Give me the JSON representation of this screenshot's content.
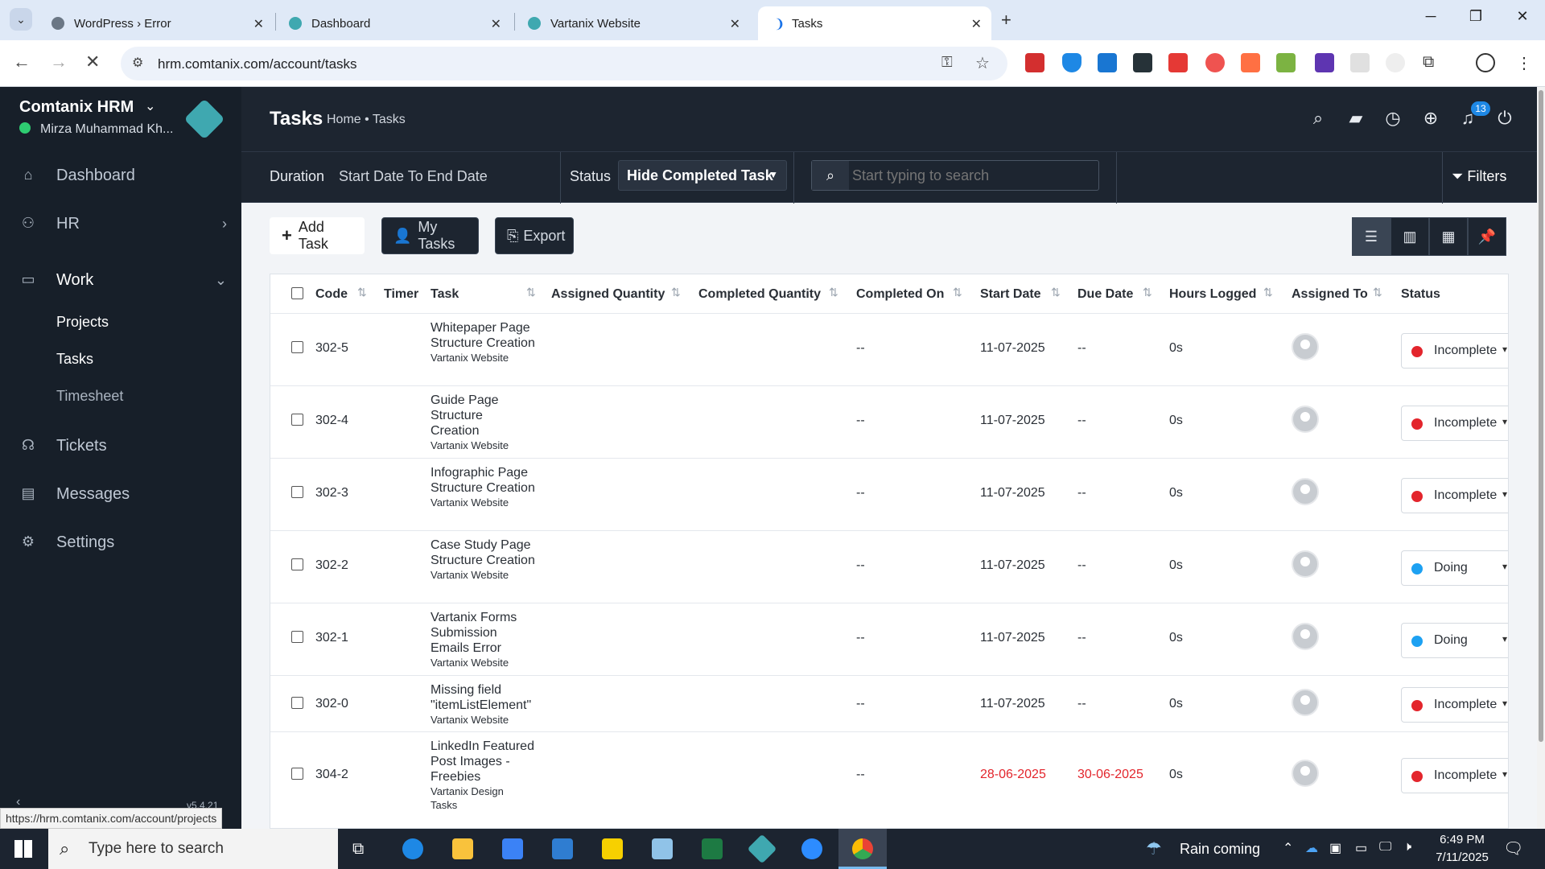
{
  "browser": {
    "tabs": [
      {
        "label": "WordPress › Error",
        "color": "#6b7785"
      },
      {
        "label": "Dashboard",
        "color": "#3fa8b0"
      },
      {
        "label": "Vartanix Website",
        "color": "#3fa8b0"
      },
      {
        "label": "Tasks",
        "color": "#1a73e8",
        "active": true
      }
    ],
    "url": "hrm.comtanix.com/account/tasks",
    "status_url": "https://hrm.comtanix.com/account/projects"
  },
  "sidebar": {
    "company": "Comtanix HRM",
    "user": "Mirza Muhammad Kh...",
    "items": [
      {
        "label": "Dashboard",
        "icon": "home-icon"
      },
      {
        "label": "HR",
        "icon": "users-icon"
      },
      {
        "label": "Work",
        "icon": "briefcase-icon"
      },
      {
        "label": "Tickets",
        "icon": "headset-icon"
      },
      {
        "label": "Messages",
        "icon": "message-icon"
      },
      {
        "label": "Settings",
        "icon": "gear-icon"
      }
    ],
    "work_sub": [
      "Projects",
      "Tasks",
      "Timesheet"
    ],
    "version": "v5.4.21"
  },
  "header": {
    "title": "Tasks",
    "breadcrumb": "Home • Tasks",
    "notification_count": "13"
  },
  "filters": {
    "duration_label": "Duration",
    "duration_value": "Start Date To End Date",
    "status_label": "Status",
    "status_value": "Hide Completed Task",
    "search_placeholder": "Start typing to search",
    "filters_label": "Filters"
  },
  "actions": {
    "add_task": "Add Task",
    "my_tasks": "My Tasks",
    "export": "Export"
  },
  "table": {
    "columns": [
      "Code",
      "Timer",
      "Task",
      "Assigned Quantity",
      "Completed Quantity",
      "Completed On",
      "Start Date",
      "Due Date",
      "Hours Logged",
      "Assigned To",
      "Status"
    ],
    "rows": [
      {
        "code": "302-5",
        "task": "Whitepaper Page Structure Creation",
        "project": "Vartanix Website",
        "completed_on": "--",
        "start": "11-07-2025",
        "due": "--",
        "hours": "0s",
        "status": "Incomplete",
        "status_color": "#e3252c",
        "overdue": false
      },
      {
        "code": "302-4",
        "task": "Guide Page Structure Creation",
        "project": "Vartanix Website",
        "completed_on": "--",
        "start": "11-07-2025",
        "due": "--",
        "hours": "0s",
        "status": "Incomplete",
        "status_color": "#e3252c",
        "overdue": false
      },
      {
        "code": "302-3",
        "task": "Infographic Page Structure Creation",
        "project": "Vartanix Website",
        "completed_on": "--",
        "start": "11-07-2025",
        "due": "--",
        "hours": "0s",
        "status": "Incomplete",
        "status_color": "#e3252c",
        "overdue": false
      },
      {
        "code": "302-2",
        "task": "Case Study Page Structure Creation",
        "project": "Vartanix Website",
        "completed_on": "--",
        "start": "11-07-2025",
        "due": "--",
        "hours": "0s",
        "status": "Doing",
        "status_color": "#1da1f2",
        "overdue": false
      },
      {
        "code": "302-1",
        "task": "Vartanix Forms Submission Emails Error",
        "project": "Vartanix Website",
        "completed_on": "--",
        "start": "11-07-2025",
        "due": "--",
        "hours": "0s",
        "status": "Doing",
        "status_color": "#1da1f2",
        "overdue": false
      },
      {
        "code": "302-0",
        "task": "Missing field \"itemListElement\"",
        "project": "Vartanix Website",
        "completed_on": "--",
        "start": "11-07-2025",
        "due": "--",
        "hours": "0s",
        "status": "Incomplete",
        "status_color": "#e3252c",
        "overdue": false
      },
      {
        "code": "304-2",
        "task": "LinkedIn Featured Post Images - Freebies",
        "project": "Vartanix Design Tasks",
        "completed_on": "--",
        "start": "28-06-2025",
        "due": "30-06-2025",
        "hours": "0s",
        "status": "Incomplete",
        "status_color": "#e3252c",
        "overdue": true
      }
    ]
  },
  "taskbar": {
    "search_placeholder": "Type here to search",
    "weather": "Rain coming",
    "time": "6:49 PM",
    "date": "7/11/2025"
  }
}
